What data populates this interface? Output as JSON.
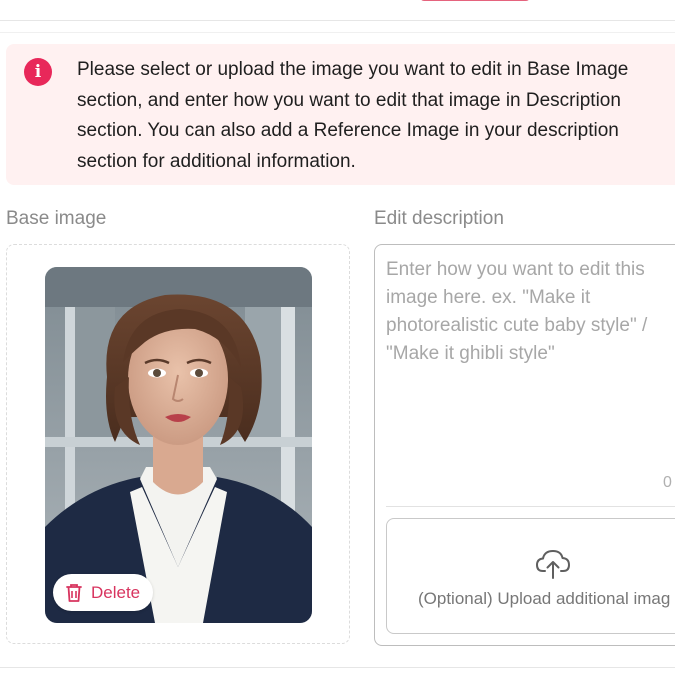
{
  "alert": {
    "icon": "info-icon",
    "icon_glyph": "i",
    "message": "Please select or upload the image you want to edit in Base Image section, and enter how you want to edit that image in Description section. You can also add a Reference Image in your description section for additional information.",
    "color": "#e8285a",
    "background": "#fff1f1"
  },
  "base_image": {
    "label": "Base image",
    "delete_label": "Delete",
    "delete_icon": "trash-icon"
  },
  "edit_description": {
    "label": "Edit description",
    "placeholder": "Enter how you want to edit this image here. ex. \"Make it photorealistic cute baby style\" / \"Make it ghibli style\"",
    "value": "",
    "char_count": "0"
  },
  "reference_upload": {
    "icon": "cloud-upload-icon",
    "label": "(Optional) Upload additional imag"
  },
  "colors": {
    "accent": "#e8285a",
    "delete_text": "#d8345f"
  }
}
